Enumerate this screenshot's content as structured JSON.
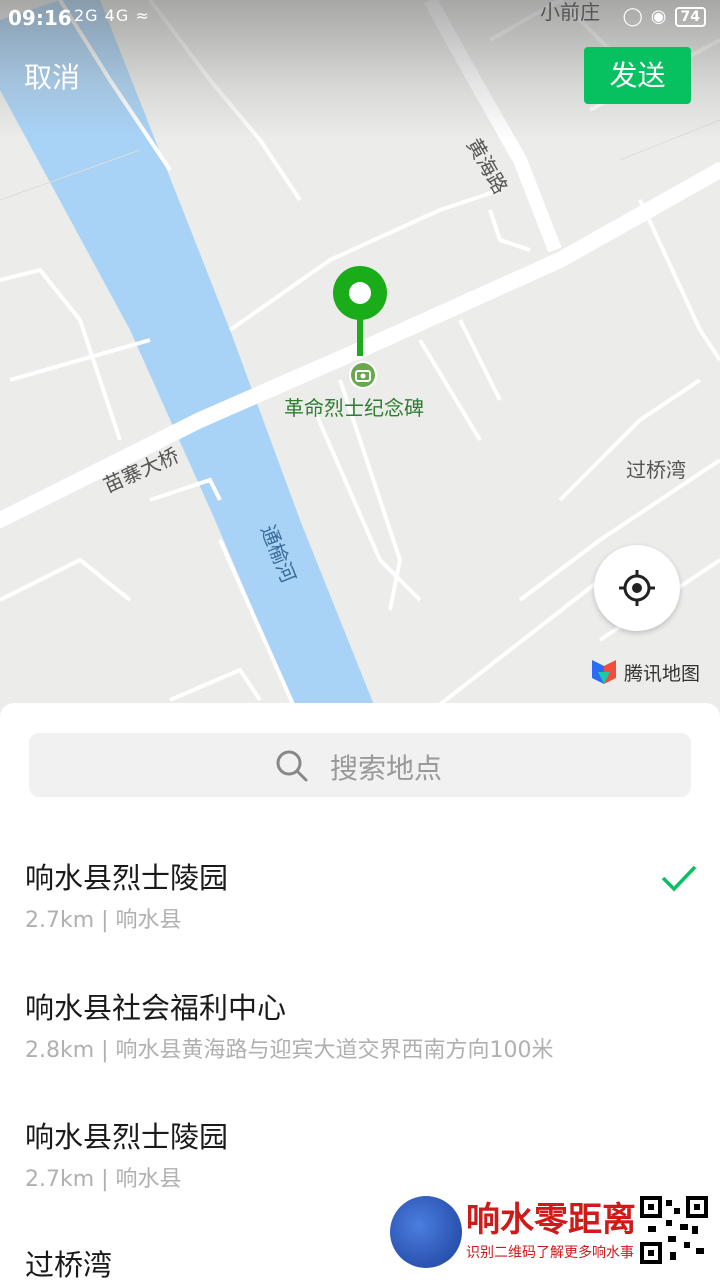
{
  "status_bar": {
    "time": "09:16",
    "signal_text": "2G 4G",
    "battery": "74"
  },
  "header": {
    "cancel_label": "取消",
    "send_label": "发送"
  },
  "map": {
    "labels": {
      "top_place": "小前庄",
      "huanghai_road": "黄海路",
      "miaozhai_bridge": "苗寨大桥",
      "tongyu_river": "通榆河",
      "guoqiaowan": "过桥湾"
    },
    "poi_label": "革命烈士纪念碑",
    "provider": "腾讯地图",
    "accent": "#07c160",
    "river_color": "#a8d3f7"
  },
  "search": {
    "placeholder": "搜索地点"
  },
  "results": [
    {
      "name": "响水县烈士陵园",
      "meta": "2.7km | 响水县",
      "selected": true
    },
    {
      "name": "响水县社会福利中心",
      "meta": "2.8km | 响水县黄海路与迎宾大道交界西南方向100米",
      "selected": false
    },
    {
      "name": "响水县烈士陵园",
      "meta": "2.7km | 响水县",
      "selected": false
    },
    {
      "name": "过桥湾",
      "meta": "",
      "selected": false
    }
  ],
  "watermark": {
    "title": "响水零距离",
    "subtitle": "识别二维码了解更多响水事"
  }
}
